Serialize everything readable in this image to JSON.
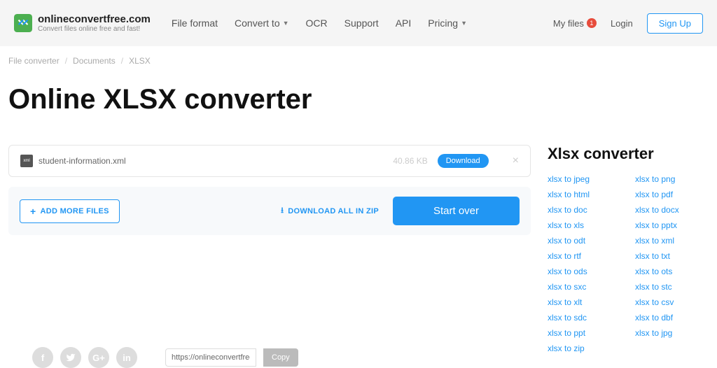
{
  "header": {
    "logo_title": "onlineconvertfree.com",
    "logo_sub": "Convert files online free and fast!",
    "nav": [
      "File format",
      "Convert to",
      "OCR",
      "Support",
      "API",
      "Pricing"
    ],
    "nav_has_caret": [
      false,
      true,
      false,
      false,
      false,
      true
    ],
    "my_files": "My files",
    "badge": "1",
    "login": "Login",
    "signup": "Sign Up"
  },
  "breadcrumb": [
    "File converter",
    "Documents",
    "XLSX"
  ],
  "title": "Online XLSX converter",
  "file": {
    "name": "student-information.xml",
    "size": "40.86 KB",
    "download": "Download"
  },
  "actions": {
    "add_more": "ADD MORE FILES",
    "download_zip": "DOWNLOAD ALL IN ZIP",
    "start_over": "Start over"
  },
  "sidebar": {
    "title": "Xlsx converter",
    "col1": [
      "xlsx to jpeg",
      "xlsx to html",
      "xlsx to doc",
      "xlsx to xls",
      "xlsx to odt",
      "xlsx to rtf",
      "xlsx to ods",
      "xlsx to sxc",
      "xlsx to xlt",
      "xlsx to sdc",
      "xlsx to ppt",
      "xlsx to zip"
    ],
    "col2": [
      "xlsx to png",
      "xlsx to pdf",
      "xlsx to docx",
      "xlsx to pptx",
      "xlsx to xml",
      "xlsx to txt",
      "xlsx to ots",
      "xlsx to stc",
      "xlsx to csv",
      "xlsx to dbf",
      "xlsx to jpg"
    ]
  },
  "share": {
    "url": "https://onlineconvertfree.c",
    "copy": "Copy"
  }
}
